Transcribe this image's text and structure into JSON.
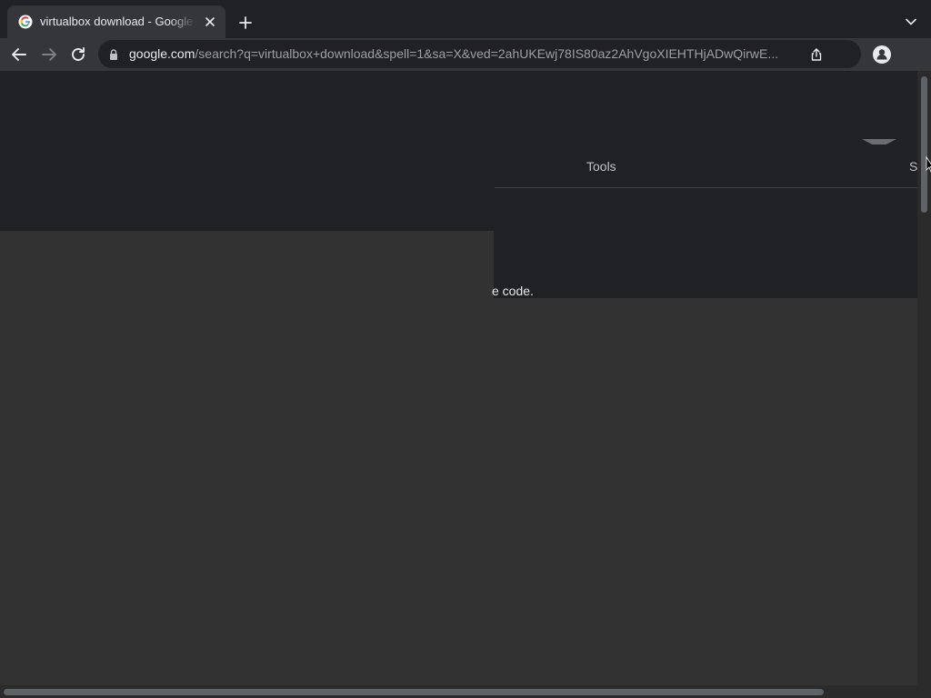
{
  "browser": {
    "tab": {
      "title": "virtualbox download - Google Search"
    },
    "address_bar": {
      "host": "google.com",
      "path": "/search?q=virtualbox+download&spell=1&sa=X&ved=2ahUKEwj78IS80az2AhVgoXIEHTHjADwQirwE..."
    },
    "icons": {
      "favicon": "google-g-icon",
      "close": "close-icon",
      "new_tab": "plus-icon",
      "tab_search": "chevron-down-icon",
      "back": "arrow-left-icon",
      "forward": "arrow-right-icon",
      "reload": "reload-icon",
      "lock": "lock-icon",
      "share": "share-icon",
      "profile": "profile-icon"
    }
  },
  "page": {
    "tools_label": "Tools",
    "cut_label": "S",
    "snippet_fragment": "e code."
  },
  "colors": {
    "chrome_dark": "#202124",
    "toolbar": "#35363a",
    "page_bg": "#323232"
  }
}
